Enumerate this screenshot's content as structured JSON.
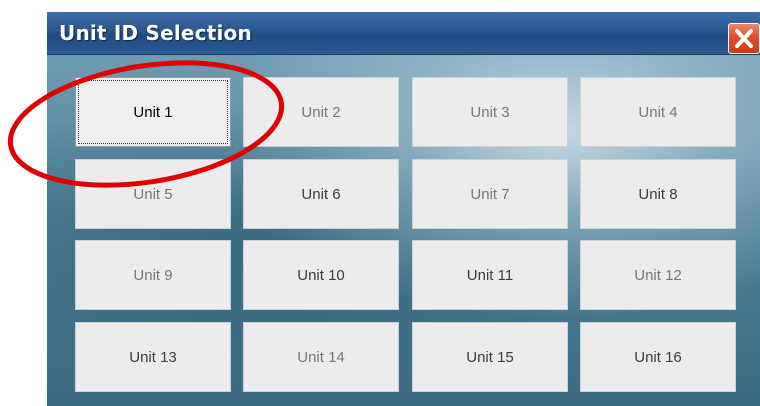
{
  "window": {
    "title": "Unit ID Selection"
  },
  "units": [
    {
      "label": "Unit 1",
      "state": "selected"
    },
    {
      "label": "Unit 2",
      "state": "dim"
    },
    {
      "label": "Unit 3",
      "state": "dim"
    },
    {
      "label": "Unit 4",
      "state": "dim"
    },
    {
      "label": "Unit 5",
      "state": "dim"
    },
    {
      "label": "Unit 6",
      "state": "normal"
    },
    {
      "label": "Unit 7",
      "state": "dim"
    },
    {
      "label": "Unit 8",
      "state": "normal"
    },
    {
      "label": "Unit 9",
      "state": "dim"
    },
    {
      "label": "Unit 10",
      "state": "normal"
    },
    {
      "label": "Unit 11",
      "state": "normal"
    },
    {
      "label": "Unit 12",
      "state": "dim"
    },
    {
      "label": "Unit 13",
      "state": "normal"
    },
    {
      "label": "Unit 14",
      "state": "dim"
    },
    {
      "label": "Unit 15",
      "state": "normal"
    },
    {
      "label": "Unit 16",
      "state": "normal"
    }
  ],
  "icons": {
    "close": "close-icon"
  },
  "colors": {
    "titlebar": "#2a5690",
    "close_button": "#e0512f",
    "annotation_circle": "#e00000",
    "button_face": "#ececec"
  }
}
